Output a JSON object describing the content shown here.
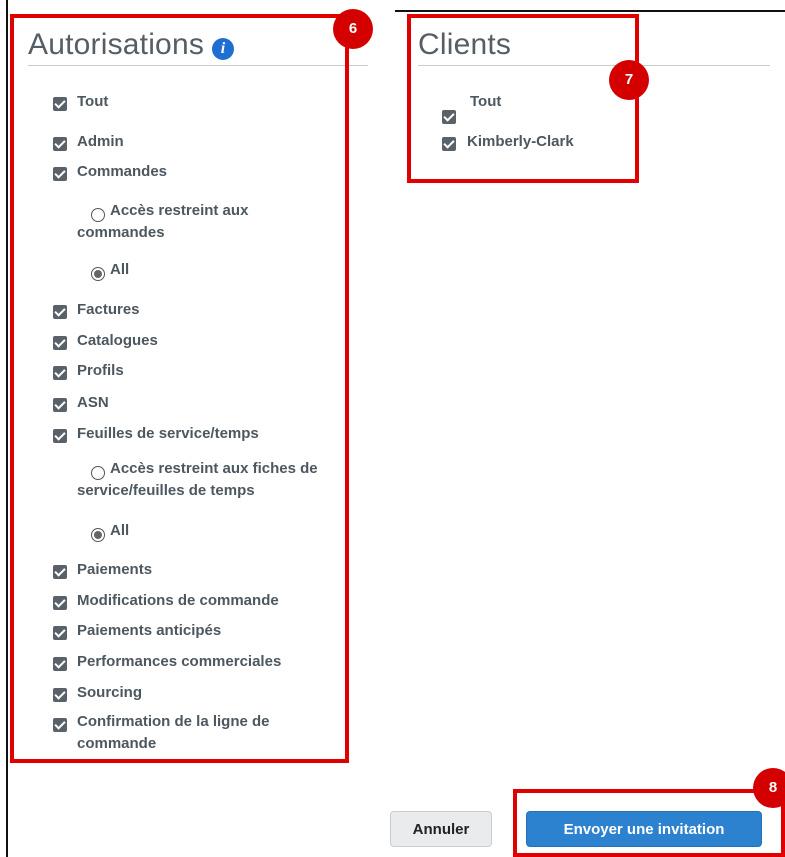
{
  "permissions": {
    "title": "Autorisations",
    "info_icon": "i",
    "items": [
      {
        "label": "Tout",
        "checked": true
      },
      {
        "label": "Admin",
        "checked": true
      },
      {
        "label": "Commandes",
        "checked": true
      },
      {
        "label": "Accès restreint aux commandes",
        "type": "radio",
        "selected": false
      },
      {
        "label": "All",
        "type": "radio",
        "selected": true
      },
      {
        "label": "Factures",
        "checked": true
      },
      {
        "label": "Catalogues",
        "checked": true
      },
      {
        "label": "Profils",
        "checked": true
      },
      {
        "label": "ASN",
        "checked": true
      },
      {
        "label": "Feuilles de service/temps",
        "checked": true
      },
      {
        "label": "Accès restreint aux fiches de service/feuilles de temps",
        "type": "radio",
        "selected": false
      },
      {
        "label": "All",
        "type": "radio",
        "selected": true
      },
      {
        "label": "Paiements",
        "checked": true
      },
      {
        "label": "Modifications de commande",
        "checked": true
      },
      {
        "label": "Paiements anticipés",
        "checked": true
      },
      {
        "label": "Performances commerciales",
        "checked": true
      },
      {
        "label": "Sourcing",
        "checked": true
      },
      {
        "label": "Confirmation de la ligne de commande",
        "checked": true
      }
    ]
  },
  "clients": {
    "title": "Clients",
    "items": [
      {
        "label": "Tout",
        "checked": true
      },
      {
        "label": "Kimberly-Clark",
        "checked": true
      }
    ]
  },
  "callouts": {
    "permissions": "6",
    "clients": "7",
    "buttons": "8"
  },
  "buttons": {
    "cancel": "Annuler",
    "send": "Envoyer une invitation"
  },
  "colors": {
    "callout_red": "#e00000",
    "primary_button": "#2d82cf",
    "checkbox": "#5a6168",
    "label_text": "#4d5760"
  }
}
